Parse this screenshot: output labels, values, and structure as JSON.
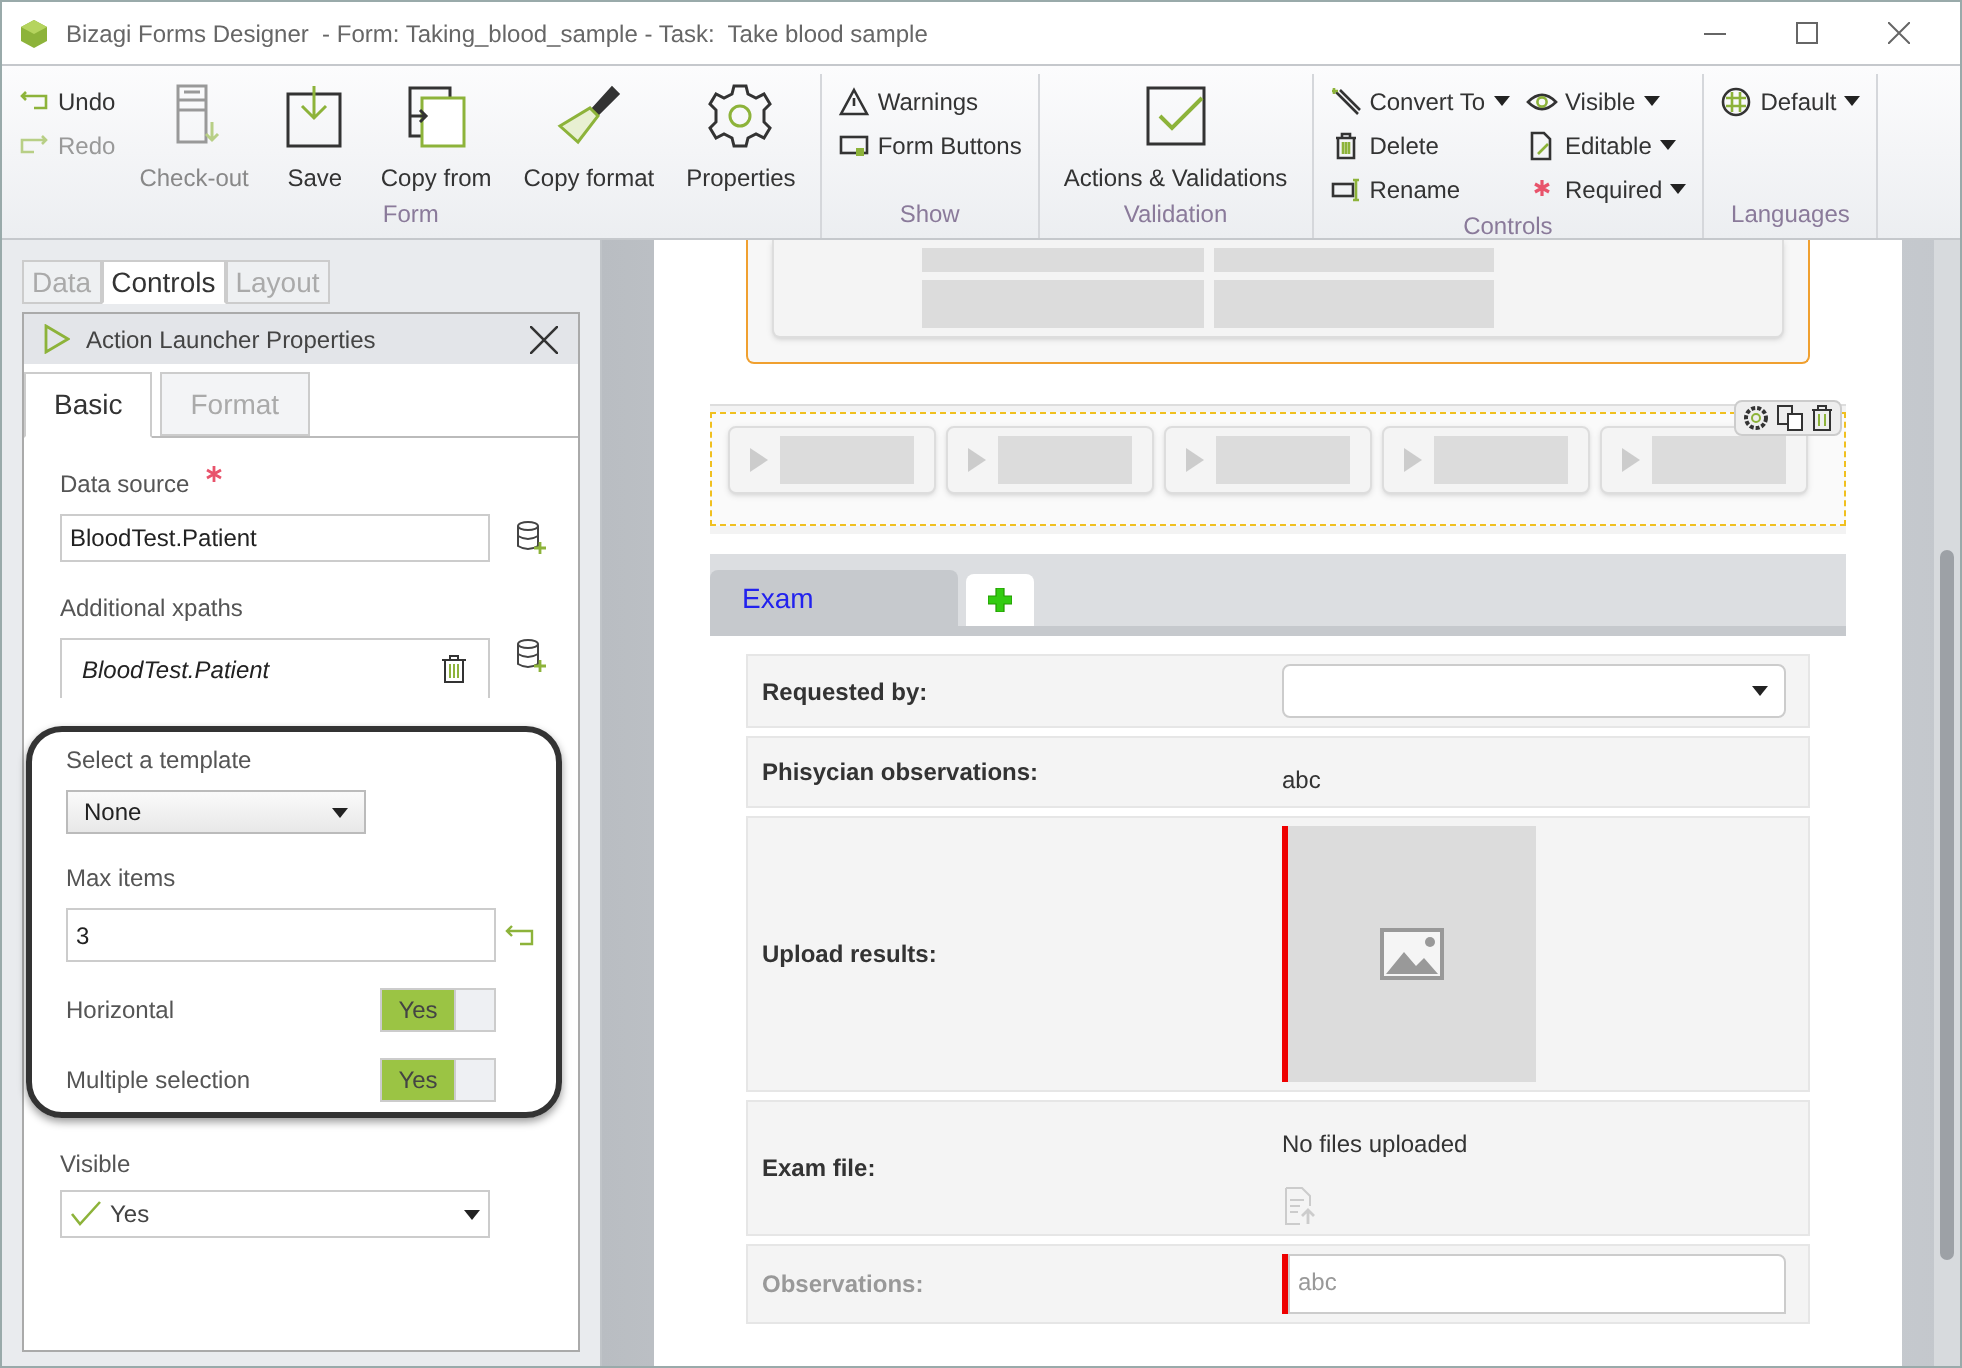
{
  "window": {
    "title": "Bizagi Forms Designer  - Form: Taking_blood_sample - Task:  Take blood sample"
  },
  "ribbon": {
    "groups": [
      {
        "label": "Form",
        "items": [
          {
            "kind": "small",
            "label": "Undo",
            "disabled": false,
            "dropdown": false
          },
          {
            "kind": "small",
            "label": "Redo",
            "disabled": true,
            "dropdown": false
          },
          {
            "kind": "large",
            "label": "Check-out",
            "disabled": true
          },
          {
            "kind": "large",
            "label": "Save",
            "disabled": false
          },
          {
            "kind": "large",
            "label": "Copy from",
            "disabled": false
          },
          {
            "kind": "large",
            "label": "Copy format",
            "disabled": false
          },
          {
            "kind": "large",
            "label": "Properties",
            "disabled": false
          }
        ]
      },
      {
        "label": "Show",
        "items": [
          {
            "kind": "small",
            "label": "Warnings",
            "disabled": false,
            "dropdown": false
          },
          {
            "kind": "small",
            "label": "Form Buttons",
            "disabled": false,
            "dropdown": false
          }
        ]
      },
      {
        "label": "Validation",
        "items": [
          {
            "kind": "large",
            "label": "Actions & Validations",
            "disabled": false
          }
        ]
      },
      {
        "label": "Controls",
        "items": [
          {
            "kind": "small",
            "label": "Convert To",
            "disabled": false,
            "dropdown": true
          },
          {
            "kind": "small",
            "label": "Delete",
            "disabled": false,
            "dropdown": false
          },
          {
            "kind": "small",
            "label": "Rename",
            "disabled": false,
            "dropdown": false
          },
          {
            "kind": "small",
            "label": "Visible",
            "disabled": false,
            "dropdown": true
          },
          {
            "kind": "small",
            "label": "Editable",
            "disabled": false,
            "dropdown": true
          },
          {
            "kind": "small",
            "label": "Required",
            "disabled": false,
            "dropdown": true
          }
        ]
      },
      {
        "label": "Languages",
        "items": [
          {
            "kind": "small",
            "label": "Default",
            "disabled": false,
            "dropdown": true
          }
        ]
      }
    ]
  },
  "panel_tabs": [
    {
      "label": "Data",
      "selected": false
    },
    {
      "label": "Controls",
      "selected": true
    },
    {
      "label": "Layout",
      "selected": false
    }
  ],
  "properties": {
    "title": "Action Launcher Properties",
    "tabs": [
      {
        "label": "Basic",
        "selected": true
      },
      {
        "label": "Format",
        "selected": false
      }
    ],
    "fields": [
      {
        "kind": "text",
        "label": "Data source",
        "value": "BloodTest.Patient",
        "required": true
      },
      {
        "kind": "list",
        "label": "Additional xpaths",
        "value": "BloodTest.Patient"
      }
    ],
    "highlight": {
      "fields": [
        {
          "kind": "select",
          "label": "Select a template",
          "value": "None"
        },
        {
          "kind": "number",
          "label": "Max items",
          "value": "3"
        },
        {
          "kind": "toggle",
          "label": "Horizontal",
          "value": "Yes",
          "on": true
        },
        {
          "kind": "toggle",
          "label": "Multiple selection",
          "value": "Yes",
          "on": true
        }
      ]
    },
    "fields_below": [
      {
        "kind": "check-select",
        "label": "Visible",
        "value": "Yes"
      }
    ]
  },
  "canvas": {
    "tabs": [
      {
        "label": "Exam",
        "selected": true
      }
    ],
    "rows": [
      {
        "kind": "combo",
        "label": "Requested by:",
        "required": false,
        "disabled": false
      },
      {
        "kind": "text",
        "label": "Phisycian observations:",
        "value": "abc",
        "required": false,
        "disabled": false
      },
      {
        "kind": "image",
        "label": "Upload results:",
        "required": true,
        "disabled": false
      },
      {
        "kind": "file",
        "label": "Exam file:",
        "value": "No files uploaded",
        "required": false,
        "disabled": false
      },
      {
        "kind": "textarea",
        "label": "Observations:",
        "value": "abc",
        "required": true,
        "disabled": true
      }
    ]
  }
}
